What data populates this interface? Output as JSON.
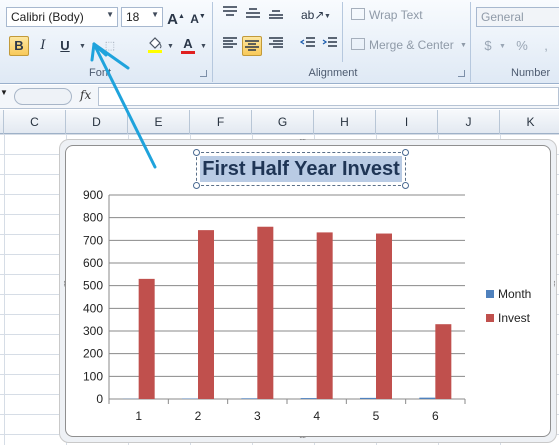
{
  "ribbon": {
    "font_group": {
      "font_name": "Calibri (Body)",
      "font_size": "18",
      "grow_glyph": "A",
      "shrink_glyph": "A",
      "bold": "B",
      "italic": "I",
      "underline": "U",
      "font_color_glyph": "A",
      "label": "Font"
    },
    "alignment_group": {
      "wrap_text": "Wrap Text",
      "merge_center": "Merge & Center",
      "label": "Alignment"
    },
    "number_group": {
      "format": "General",
      "currency": "$",
      "percent": "%",
      "comma": ",",
      "label": "Number"
    }
  },
  "formula_bar": {
    "fx": "fx"
  },
  "columns": [
    "C",
    "D",
    "E",
    "F",
    "G",
    "H",
    "I",
    "J",
    "K"
  ],
  "colors": {
    "invest": "#c0504d",
    "month": "#4f81bd",
    "selection": "#b9cbe4",
    "arrow": "#1fa3dc"
  },
  "chart_data": {
    "type": "bar",
    "title": "First Half Year Invest",
    "categories": [
      "1",
      "2",
      "3",
      "4",
      "5",
      "6"
    ],
    "ylim": [
      0,
      900
    ],
    "yticks": [
      "0",
      "100",
      "200",
      "300",
      "400",
      "500",
      "600",
      "700",
      "800",
      "900"
    ],
    "series": [
      {
        "name": "Month",
        "values": [
          1,
          2,
          3,
          4,
          5,
          6
        ]
      },
      {
        "name": "Invest",
        "values": [
          530,
          745,
          760,
          735,
          730,
          330
        ]
      }
    ],
    "legend_position": "right",
    "grid": true
  }
}
